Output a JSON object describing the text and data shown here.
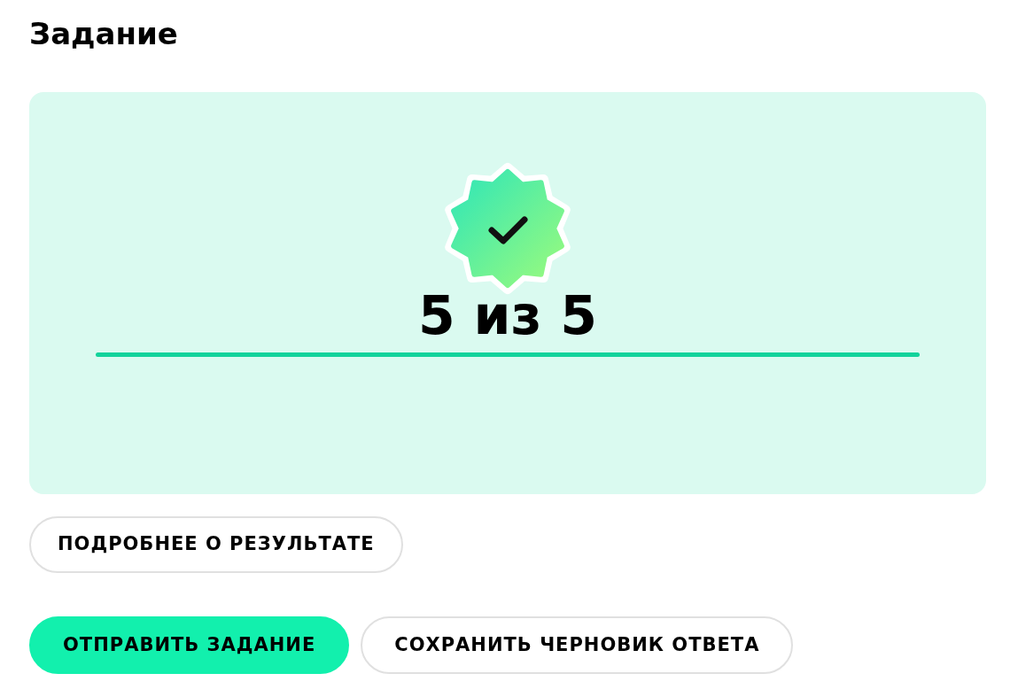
{
  "title": "Задание",
  "result": {
    "score": "5 из 5"
  },
  "details_button": "ПОДРОБНЕЕ О РЕЗУЛЬТАТЕ",
  "actions": [
    {
      "label": "ОТПРАВИТЬ ЗАДАНИЕ",
      "kind": "primary"
    },
    {
      "label": "СОХРАНИТЬ ЧЕРНОВИК ОТВЕТА",
      "kind": "secondary"
    }
  ]
}
